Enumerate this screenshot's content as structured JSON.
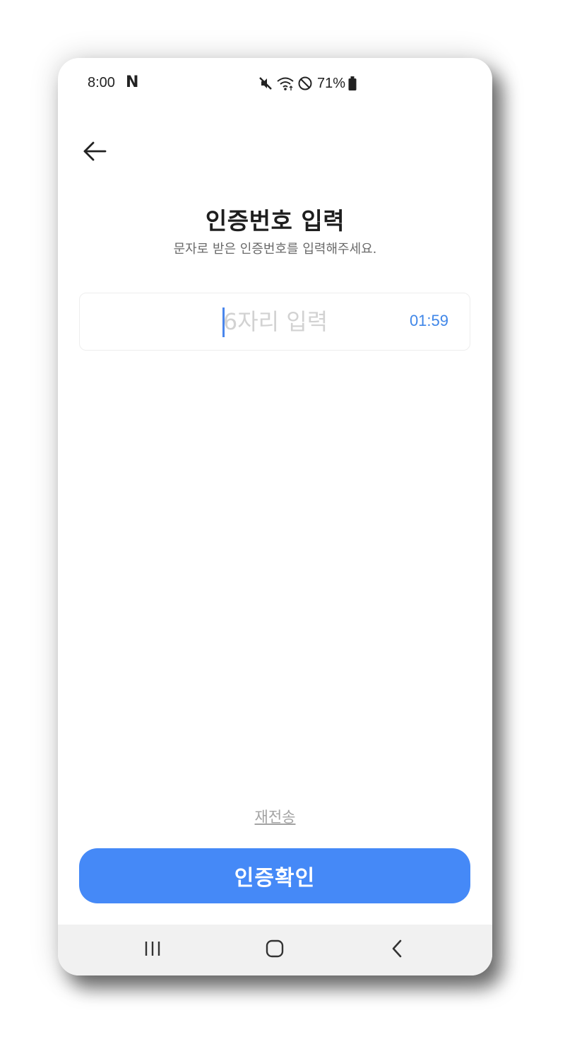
{
  "status_bar": {
    "time": "8:00",
    "notification_glyph": "N",
    "battery_percent": "71%",
    "icons": [
      "mute-icon",
      "wifi-icon",
      "do-not-disturb-icon",
      "battery-icon"
    ]
  },
  "header": {
    "back_icon": "arrow-left-icon"
  },
  "main": {
    "title": "인증번호 입력",
    "subtitle": "문자로 받은 인증번호를 입력해주세요.",
    "code_input": {
      "value": "",
      "placeholder": "6자리 입력"
    },
    "timer": "01:59",
    "resend_link": "재전송",
    "confirm_button": "인증확인"
  },
  "nav_bar": {
    "buttons": [
      "recent-apps-icon",
      "home-icon",
      "back-icon"
    ]
  },
  "colors": {
    "accent": "#4589f7",
    "timer": "#3f86e8",
    "title": "#1e1e1e",
    "subtitle": "#6a6a6a",
    "placeholder": "#d2d2d2",
    "resend": "#a3a3a3",
    "nav_background": "#f1f1f1"
  }
}
